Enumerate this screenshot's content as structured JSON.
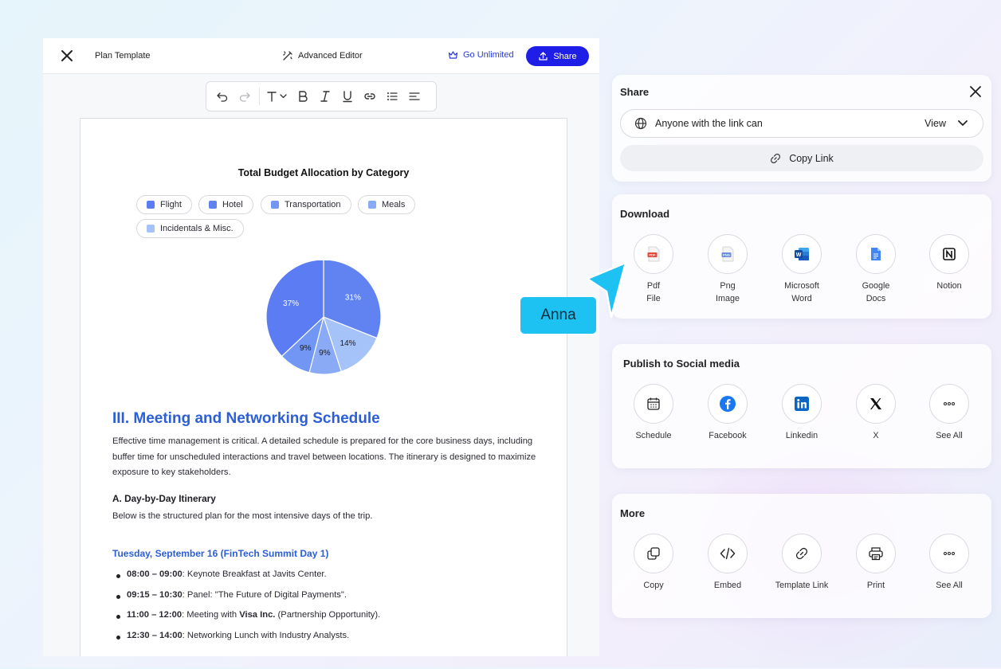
{
  "editor": {
    "title": "Plan Template",
    "advanced_editor": "Advanced Editor",
    "go_unlimited": "Go Unlimited",
    "share": "Share",
    "toolbar_icons": [
      "undo-icon",
      "redo-icon",
      "text-style-icon",
      "bold-icon",
      "italic-icon",
      "underline-icon",
      "link-icon",
      "list-icon",
      "align-left-icon"
    ]
  },
  "document": {
    "chart_data": {
      "type": "pie",
      "title": "Total Budget Allocation by Category",
      "legend": [
        "Flight",
        "Hotel",
        "Transportation",
        "Meals",
        "Incidentals & Misc."
      ],
      "colors": [
        "#5b7cf2",
        "#6183f2",
        "#7196f3",
        "#8aaaf5",
        "#a5c3f8"
      ],
      "slices": [
        {
          "name": "Hotel",
          "value": 31,
          "label": "31%"
        },
        {
          "name": "Incidentals & Misc.",
          "value": 14,
          "label": "14%"
        },
        {
          "name": "Meals",
          "value": 9,
          "label": "9%"
        },
        {
          "name": "Transportation",
          "value": 9,
          "label": "9%"
        },
        {
          "name": "Flight",
          "value": 37,
          "label": "37%"
        }
      ]
    },
    "section_heading": "III. Meeting and Networking Schedule",
    "intro": "Effective time management is critical. A detailed schedule is prepared for the core business days, including buffer time for unscheduled interactions and travel between locations. The itinerary is designed to maximize exposure to key stakeholders.",
    "sub_heading": "A. Day-by-Day Itinerary",
    "sub_text": "Below is the structured plan for the most intensive days of the trip.",
    "day_heading": "Tuesday, September 16 (FinTech Summit Day 1)",
    "schedule": [
      {
        "time": "08:00 – 09:00",
        "text": ": Keynote Breakfast at Javits Center."
      },
      {
        "time": "09:15 – 10:30",
        "text": ": Panel: \"The Future of Digital Payments\"."
      },
      {
        "time": "11:00 – 12:00",
        "text": ": Meeting with ",
        "bold": "Visa Inc.",
        "tail": " (Partnership Opportunity)."
      },
      {
        "time": "12:30 – 14:00",
        "text": ": Networking Lunch with Industry Analysts."
      }
    ]
  },
  "share_panel": {
    "title": "Share",
    "access_text": "Anyone with the link can",
    "access_value": "View",
    "copy_link": "Copy Link"
  },
  "download_panel": {
    "title": "Download",
    "items": [
      {
        "label1": "Pdf",
        "label2": "File",
        "icon": "pdf-icon"
      },
      {
        "label1": "Png",
        "label2": "Image",
        "icon": "png-icon"
      },
      {
        "label1": "Microsoft",
        "label2": "Word",
        "icon": "word-icon"
      },
      {
        "label1": "Google",
        "label2": "Docs",
        "icon": "google-docs-icon"
      },
      {
        "label1": "Notion",
        "label2": "",
        "icon": "notion-icon"
      }
    ]
  },
  "social_panel": {
    "title": "Publish to Social media",
    "items": [
      {
        "label": "Schedule",
        "icon": "calendar-icon"
      },
      {
        "label": "Facebook",
        "icon": "facebook-icon"
      },
      {
        "label": "Linkedin",
        "icon": "linkedin-icon"
      },
      {
        "label": "X",
        "icon": "x-icon"
      },
      {
        "label": "See All",
        "icon": "more-icon"
      }
    ]
  },
  "more_panel": {
    "title": "More",
    "items": [
      {
        "label": "Copy",
        "icon": "copy-icon"
      },
      {
        "label": "Embed",
        "icon": "embed-icon"
      },
      {
        "label": "Template Link",
        "icon": "link-icon"
      },
      {
        "label": "Print",
        "icon": "print-icon"
      },
      {
        "label": "See All",
        "icon": "more-icon"
      }
    ]
  },
  "collaborator": {
    "name": "Anna",
    "color": "#1ec2f2"
  }
}
